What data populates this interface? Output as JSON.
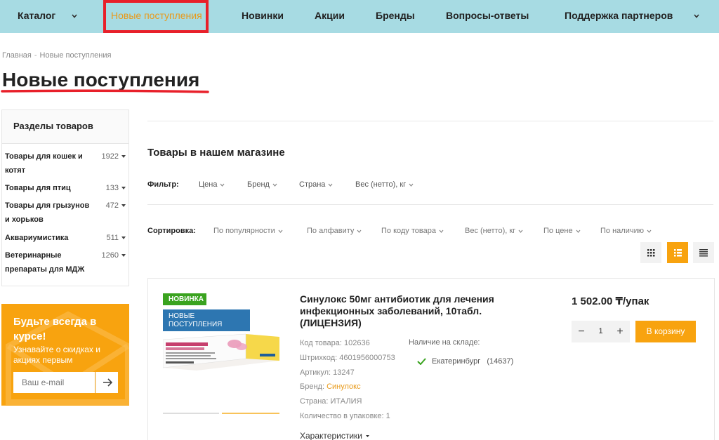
{
  "nav": {
    "catalog": "Каталог",
    "new_arrivals": "Новые поступления",
    "novelties": "Новинки",
    "promotions": "Акции",
    "brands": "Бренды",
    "faq": "Вопросы-ответы",
    "partner_support": "Поддержка партнеров"
  },
  "breadcrumb": {
    "home": "Главная",
    "separator": "-",
    "current": "Новые поступления"
  },
  "page_title": "Новые поступления",
  "sidebar": {
    "title": "Разделы товаров",
    "items": [
      {
        "label": "Товары для кошек и котят",
        "count": "1922"
      },
      {
        "label": "Товары для птиц",
        "count": "133"
      },
      {
        "label": "Товары для грызунов и хорьков",
        "count": "472"
      },
      {
        "label": "Аквариумистика",
        "count": "511"
      },
      {
        "label": "Ветеринарные препараты для МДЖ",
        "count": "1260"
      }
    ]
  },
  "promo": {
    "title": "Будьте всегда в курсе!",
    "text": "Узнавайте о скидках и акциях первым",
    "email_placeholder": "Ваш e-mail"
  },
  "main": {
    "section_title": "Товары в нашем магазине",
    "filter_label": "Фильтр:",
    "filters": [
      "Цена",
      "Бренд",
      "Страна",
      "Вес (нетто), кг"
    ],
    "sort_label": "Сортировка:",
    "sorts": [
      "По популярности",
      "По алфавиту",
      "По коду товара",
      "Вес (нетто), кг",
      "По цене",
      "По наличию"
    ]
  },
  "product": {
    "badge_new": "НОВИНКА",
    "badge_arrivals": "НОВЫЕ ПОСТУПЛЕНИЯ",
    "name": "Синулокс 50мг антибиотик для лечения инфекционных заболеваний, 10табл. (ЛИЦЕНЗИЯ)",
    "code": "Код товара: 102636",
    "barcode": "Штрихкод: 4601956000753",
    "article": "Артикул: 13247",
    "brand_label": "Бренд:",
    "brand_value": "Синулокс",
    "country": "Страна: ИТАЛИЯ",
    "pack_qty": "Количество в упаковке: 1",
    "stock_label": "Наличие на складе:",
    "stock_city": "Екатеринбург",
    "stock_count": "(14637)",
    "specs": "Характеристики",
    "price": "1 502.00 ₸/упак",
    "qty": "1",
    "qty_minus": "−",
    "qty_plus": "+",
    "cart_button": "В корзину"
  },
  "colors": {
    "nav_bg": "#a7dbe3",
    "accent_orange": "#f8a30f",
    "highlight_red": "#e8202a",
    "badge_green": "#3aa31f",
    "badge_blue": "#2d76b1"
  }
}
